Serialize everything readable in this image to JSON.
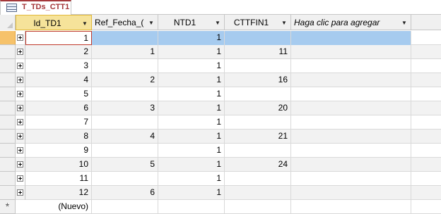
{
  "tab": {
    "label": "T_TDs_CTT1",
    "icon": "table-icon",
    "accent": "#a4373a"
  },
  "columns": [
    {
      "label": "Id_TD1",
      "has_dropdown": true,
      "italic": false
    },
    {
      "label": "Ref_Fecha_(",
      "has_dropdown": true,
      "italic": false
    },
    {
      "label": "NTD1",
      "has_dropdown": true,
      "italic": false
    },
    {
      "label": "CTTFIN1",
      "has_dropdown": true,
      "italic": false
    },
    {
      "label": "Haga clic para agregar",
      "has_dropdown": true,
      "italic": true
    }
  ],
  "rows": [
    {
      "id": "1",
      "ref": "",
      "ntd": "1",
      "cttfin": ""
    },
    {
      "id": "2",
      "ref": "1",
      "ntd": "1",
      "cttfin": "11"
    },
    {
      "id": "3",
      "ref": "",
      "ntd": "1",
      "cttfin": ""
    },
    {
      "id": "4",
      "ref": "2",
      "ntd": "1",
      "cttfin": "16"
    },
    {
      "id": "5",
      "ref": "",
      "ntd": "1",
      "cttfin": ""
    },
    {
      "id": "6",
      "ref": "3",
      "ntd": "1",
      "cttfin": "20"
    },
    {
      "id": "7",
      "ref": "",
      "ntd": "1",
      "cttfin": ""
    },
    {
      "id": "8",
      "ref": "4",
      "ntd": "1",
      "cttfin": "21"
    },
    {
      "id": "9",
      "ref": "",
      "ntd": "1",
      "cttfin": ""
    },
    {
      "id": "10",
      "ref": "5",
      "ntd": "1",
      "cttfin": "24"
    },
    {
      "id": "11",
      "ref": "",
      "ntd": "1",
      "cttfin": ""
    },
    {
      "id": "12",
      "ref": "6",
      "ntd": "1",
      "cttfin": ""
    }
  ],
  "new_row": {
    "marker": "*",
    "label": "(Nuevo)"
  },
  "colors": {
    "selected_row": "#a6cbef",
    "header_active": "#f6e39a"
  }
}
